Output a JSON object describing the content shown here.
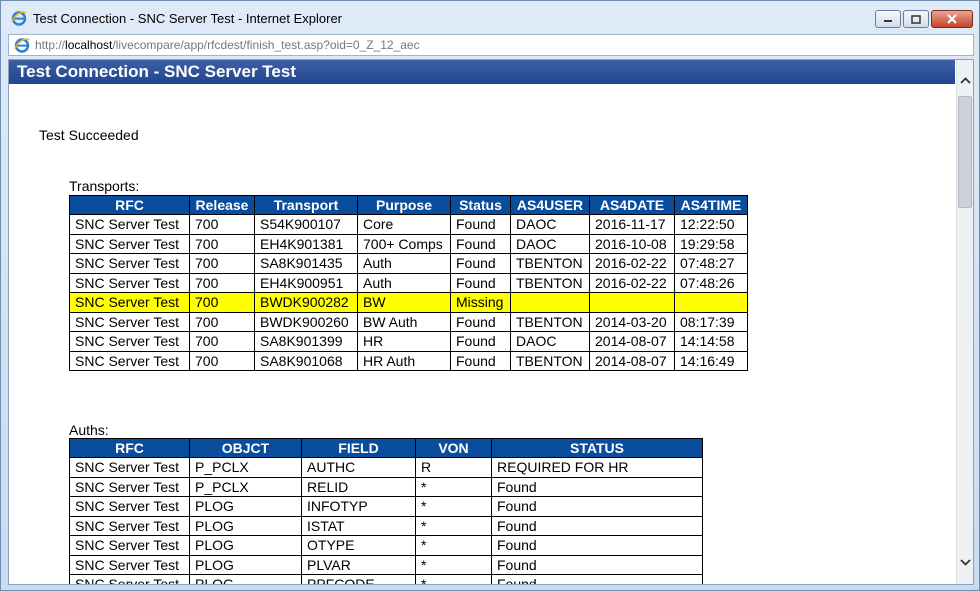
{
  "window": {
    "title": "Test Connection - SNC Server Test - Internet Explorer",
    "url_prefix": "http://",
    "url_host": "localhost",
    "url_path": "/livecompare/app/rfcdest/finish_test.asp?oid=0_Z_12_aec"
  },
  "page": {
    "header": "Test Connection - SNC Server Test",
    "status": "Test Succeeded"
  },
  "transports": {
    "label": "Transports:",
    "columns": [
      "RFC",
      "Release",
      "Transport",
      "Purpose",
      "Status",
      "AS4USER",
      "AS4DATE",
      "AS4TIME"
    ],
    "rows": [
      [
        "SNC Server Test",
        "700",
        "S54K900107",
        "Core",
        "Found",
        "DAOC",
        "2016-11-17",
        "12:22:50"
      ],
      [
        "SNC Server Test",
        "700",
        "EH4K901381",
        "700+ Comps",
        "Found",
        "DAOC",
        "2016-10-08",
        "19:29:58"
      ],
      [
        "SNC Server Test",
        "700",
        "SA8K901435",
        "Auth",
        "Found",
        "TBENTON",
        "2016-02-22",
        "07:48:27"
      ],
      [
        "SNC Server Test",
        "700",
        "EH4K900951",
        "Auth",
        "Found",
        "TBENTON",
        "2016-02-22",
        "07:48:26"
      ],
      [
        "SNC Server Test",
        "700",
        "BWDK900282",
        "BW",
        "Missing",
        "",
        "",
        ""
      ],
      [
        "SNC Server Test",
        "700",
        "BWDK900260",
        "BW Auth",
        "Found",
        "TBENTON",
        "2014-03-20",
        "08:17:39"
      ],
      [
        "SNC Server Test",
        "700",
        "SA8K901399",
        "HR",
        "Found",
        "DAOC",
        "2014-08-07",
        "14:14:58"
      ],
      [
        "SNC Server Test",
        "700",
        "SA8K901068",
        "HR Auth",
        "Found",
        "TBENTON",
        "2014-08-07",
        "14:16:49"
      ]
    ],
    "highlight_color": "#ffff00"
  },
  "auths": {
    "label": "Auths:",
    "columns": [
      "RFC",
      "OBJCT",
      "FIELD",
      "VON",
      "STATUS"
    ],
    "rows": [
      [
        "SNC Server Test",
        "P_PCLX",
        "AUTHC",
        "R",
        "REQUIRED FOR HR"
      ],
      [
        "SNC Server Test",
        "P_PCLX",
        "RELID",
        "*",
        "Found"
      ],
      [
        "SNC Server Test",
        "PLOG",
        "INFOTYP",
        "*",
        "Found"
      ],
      [
        "SNC Server Test",
        "PLOG",
        "ISTAT",
        "*",
        "Found"
      ],
      [
        "SNC Server Test",
        "PLOG",
        "OTYPE",
        "*",
        "Found"
      ],
      [
        "SNC Server Test",
        "PLOG",
        "PLVAR",
        "*",
        "Found"
      ],
      [
        "SNC Server Test",
        "PLOG",
        "PPFCODE",
        "*",
        "Found"
      ]
    ]
  },
  "colors": {
    "header_bg": "#0a4d9d",
    "page_header_bg": "#2a4f98"
  }
}
